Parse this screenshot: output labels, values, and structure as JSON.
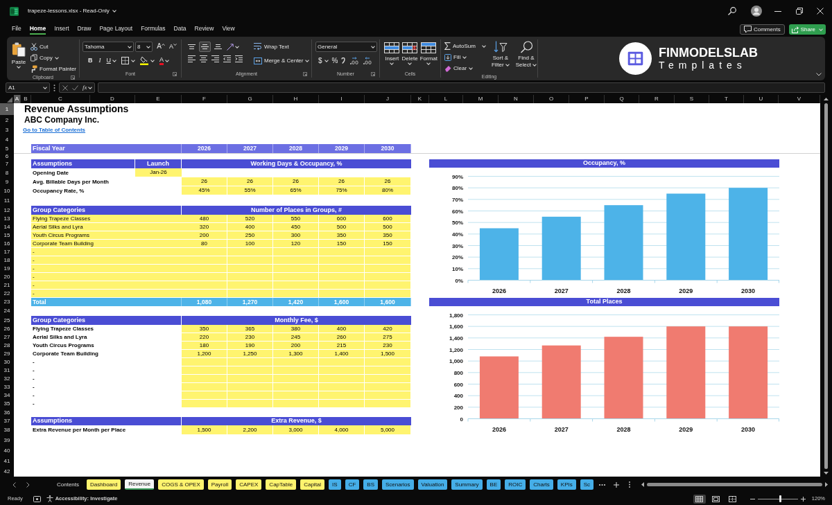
{
  "window": {
    "title": "trapeze-lessons.xlsx - Read-Only"
  },
  "menu_tabs": [
    {
      "label": "File",
      "selected": false
    },
    {
      "label": "Home",
      "selected": true
    },
    {
      "label": "Insert",
      "selected": false
    },
    {
      "label": "Draw",
      "selected": false
    },
    {
      "label": "Page Layout",
      "selected": false
    },
    {
      "label": "Formulas",
      "selected": false
    },
    {
      "label": "Data",
      "selected": false
    },
    {
      "label": "Review",
      "selected": false
    },
    {
      "label": "View",
      "selected": false
    }
  ],
  "actions": {
    "comments": "Comments",
    "share": "Share"
  },
  "ribbon": {
    "clipboard": {
      "label": "Clipboard",
      "paste": "Paste",
      "cut": "Cut",
      "copy": "Copy",
      "format_painter": "Format Painter"
    },
    "font": {
      "label": "Font",
      "font_name": "Tahoma",
      "font_size": "8",
      "grow": "A",
      "shrink": "A",
      "bold": "B",
      "italic": "I",
      "underline": "U",
      "font_color": "A"
    },
    "alignment": {
      "label": "Alignment",
      "vertical_align": [
        {
          "kind": "top",
          "selected": false
        },
        {
          "kind": "middle",
          "selected": true
        },
        {
          "kind": "bottom",
          "selected": false
        }
      ],
      "wrap_text": "Wrap Text",
      "merge_center": "Merge & Center"
    },
    "number": {
      "label": "Number",
      "format": "General",
      "currency": "$",
      "percent": "%"
    },
    "cells": {
      "label": "Cells",
      "buttons": [
        {
          "kind": "insert",
          "label": "Insert"
        },
        {
          "kind": "delete",
          "label": "Delete"
        },
        {
          "kind": "format",
          "label": "Format"
        }
      ]
    },
    "editing": {
      "label": "Editing",
      "autosum": "AutoSum",
      "fill": "Fill",
      "clear": "Clear",
      "sort_filter": "Sort & Filter",
      "find_select": "Find & Select"
    }
  },
  "logo": {
    "name": "FINMODELSLAB",
    "tagline": "Templates"
  },
  "formula_bar": {
    "cell": "A1",
    "function_label": "fx"
  },
  "columns": [
    {
      "label": "A",
      "selected": true
    },
    {
      "label": "B",
      "selected": false
    },
    {
      "label": "C",
      "selected": false
    },
    {
      "label": "D",
      "selected": false
    },
    {
      "label": "E",
      "selected": false
    },
    {
      "label": "F",
      "selected": false
    },
    {
      "label": "G",
      "selected": false
    },
    {
      "label": "H",
      "selected": false
    },
    {
      "label": "I",
      "selected": false
    },
    {
      "label": "J",
      "selected": false
    },
    {
      "label": "K",
      "selected": false
    },
    {
      "label": "L",
      "selected": false
    },
    {
      "label": "M",
      "selected": false
    },
    {
      "label": "N",
      "selected": false
    },
    {
      "label": "O",
      "selected": false
    },
    {
      "label": "P",
      "selected": false
    },
    {
      "label": "Q",
      "selected": false
    },
    {
      "label": "R",
      "selected": false
    },
    {
      "label": "S",
      "selected": false
    },
    {
      "label": "T",
      "selected": false
    },
    {
      "label": "U",
      "selected": false
    },
    {
      "label": "V",
      "selected": false
    }
  ],
  "row_numbers": [
    {
      "label": "1",
      "selected": true
    },
    {
      "label": "2",
      "selected": false
    },
    {
      "label": "3",
      "selected": false
    },
    {
      "label": "4",
      "selected": false
    },
    {
      "label": "5",
      "selected": false
    },
    {
      "label": "6",
      "selected": false
    },
    {
      "label": "7",
      "selected": false
    },
    {
      "label": "8",
      "selected": false
    },
    {
      "label": "9",
      "selected": false
    },
    {
      "label": "10",
      "selected": false
    },
    {
      "label": "11",
      "selected": false
    },
    {
      "label": "12",
      "selected": false
    },
    {
      "label": "13",
      "selected": false
    },
    {
      "label": "14",
      "selected": false
    },
    {
      "label": "15",
      "selected": false
    },
    {
      "label": "16",
      "selected": false
    },
    {
      "label": "17",
      "selected": false
    },
    {
      "label": "18",
      "selected": false
    },
    {
      "label": "19",
      "selected": false
    },
    {
      "label": "20",
      "selected": false
    },
    {
      "label": "21",
      "selected": false
    },
    {
      "label": "22",
      "selected": false
    },
    {
      "label": "23",
      "selected": false
    },
    {
      "label": "24",
      "selected": false
    },
    {
      "label": "25",
      "selected": false
    },
    {
      "label": "26",
      "selected": false
    },
    {
      "label": "27",
      "selected": false
    },
    {
      "label": "28",
      "selected": false
    },
    {
      "label": "29",
      "selected": false
    },
    {
      "label": "30",
      "selected": false
    },
    {
      "label": "31",
      "selected": false
    },
    {
      "label": "32",
      "selected": false
    },
    {
      "label": "33",
      "selected": false
    },
    {
      "label": "34",
      "selected": false
    },
    {
      "label": "35",
      "selected": false
    },
    {
      "label": "36",
      "selected": false
    },
    {
      "label": "37",
      "selected": false
    },
    {
      "label": "38",
      "selected": false
    },
    {
      "label": "39",
      "selected": false
    },
    {
      "label": "40",
      "selected": false
    },
    {
      "label": "41",
      "selected": false
    },
    {
      "label": "42",
      "selected": false
    }
  ],
  "sheet": {
    "title": "Revenue Assumptions",
    "subtitle": "ABC Company Inc.",
    "toc_link": "Go to Table of Contents",
    "fiscal_year": {
      "label": "Fiscal Year",
      "years": [
        "2026",
        "2027",
        "2028",
        "2029",
        "2030"
      ]
    },
    "sections": [
      {
        "header": {
          "label": "Assumptions",
          "launch": "Launch",
          "title": "Working Days & Occupancy, %"
        },
        "rows": [
          {
            "label": "Opening Date",
            "input_label": false,
            "launch": "Jan-26",
            "input_values": false
          },
          {
            "label": "Avg. Billable Days per Month",
            "input_label": false,
            "input_values": true,
            "values": [
              "26",
              "26",
              "26",
              "26",
              "26"
            ]
          },
          {
            "label": "Occupancy Rate, %",
            "input_label": false,
            "input_values": true,
            "values": [
              "45%",
              "55%",
              "65%",
              "75%",
              "80%"
            ]
          }
        ]
      },
      {
        "header": {
          "label": "Group Categories",
          "title": "Number of Places in Groups, #"
        },
        "rows": [
          {
            "label": "Flying Trapeze Classes",
            "input_label": true,
            "input_values": true,
            "values": [
              "480",
              "520",
              "550",
              "600",
              "600"
            ]
          },
          {
            "label": "Aerial Silks and Lyra",
            "input_label": true,
            "input_values": true,
            "values": [
              "320",
              "400",
              "450",
              "500",
              "500"
            ]
          },
          {
            "label": "Youth Circus Programs",
            "input_label": true,
            "input_values": true,
            "values": [
              "200",
              "250",
              "300",
              "350",
              "350"
            ]
          },
          {
            "label": "Corporate Team Building",
            "input_label": true,
            "input_values": true,
            "values": [
              "80",
              "100",
              "120",
              "150",
              "150"
            ]
          },
          {
            "label": "-",
            "input_label": true,
            "input_values": true
          },
          {
            "label": "-",
            "input_label": true,
            "input_values": true
          },
          {
            "label": "-",
            "input_label": true,
            "input_values": true
          },
          {
            "label": "-",
            "input_label": true,
            "input_values": true
          },
          {
            "label": "-",
            "input_label": true,
            "input_values": true
          },
          {
            "label": "-",
            "input_label": true,
            "input_values": true
          }
        ],
        "total": {
          "label": "Total",
          "values": [
            "1,080",
            "1,270",
            "1,420",
            "1,600",
            "1,600"
          ]
        }
      },
      {
        "header": {
          "label": "Group Categories",
          "title": "Monthly Fee, $"
        },
        "rows": [
          {
            "label": "Flying Trapeze Classes",
            "input_label": false,
            "input_values": true,
            "values": [
              "350",
              "365",
              "380",
              "400",
              "420"
            ]
          },
          {
            "label": "Aerial Silks and Lyra",
            "input_label": false,
            "input_values": true,
            "values": [
              "220",
              "230",
              "245",
              "260",
              "275"
            ]
          },
          {
            "label": "Youth Circus Programs",
            "input_label": false,
            "input_values": true,
            "values": [
              "180",
              "190",
              "200",
              "215",
              "230"
            ]
          },
          {
            "label": "Corporate Team Building",
            "input_label": false,
            "input_values": true,
            "values": [
              "1,200",
              "1,250",
              "1,300",
              "1,400",
              "1,500"
            ]
          },
          {
            "label": "-",
            "input_label": false,
            "input_values": true
          },
          {
            "label": "-",
            "input_label": false,
            "input_values": true
          },
          {
            "label": "-",
            "input_label": false,
            "input_values": true
          },
          {
            "label": "-",
            "input_label": false,
            "input_values": true
          },
          {
            "label": "-",
            "input_label": false,
            "input_values": true
          },
          {
            "label": "-",
            "input_label": false,
            "input_values": true
          }
        ]
      },
      {
        "header": {
          "label": "Assumptions",
          "title": "Extra Revenue, $"
        },
        "rows": [
          {
            "label": "Extra Revenue per Month per Place",
            "input_label": false,
            "input_values": true,
            "values": [
              "1,500",
              "2,200",
              "3,000",
              "4,000",
              "5,000"
            ]
          }
        ]
      }
    ]
  },
  "charts": [
    {
      "chart_data": {
        "type": "bar",
        "title": "Occupancy, %",
        "categories": [
          "2026",
          "2027",
          "2028",
          "2029",
          "2030"
        ],
        "series": [
          {
            "color": "#4db3e8",
            "values": [
              45,
              55,
              65,
              75,
              80
            ]
          }
        ],
        "ylim": [
          0,
          90
        ],
        "yticks": [
          {
            "value": 0,
            "label": "0%"
          },
          {
            "value": 10,
            "label": "10%"
          },
          {
            "value": 20,
            "label": "20%"
          },
          {
            "value": 30,
            "label": "30%"
          },
          {
            "value": 40,
            "label": "40%"
          },
          {
            "value": 50,
            "label": "50%"
          },
          {
            "value": 60,
            "label": "60%"
          },
          {
            "value": 70,
            "label": "70%"
          },
          {
            "value": 80,
            "label": "80%"
          },
          {
            "value": 90,
            "label": "90%"
          }
        ],
        "grid": true
      }
    },
    {
      "chart_data": {
        "type": "bar",
        "title": "Total Places",
        "categories": [
          "2026",
          "2027",
          "2028",
          "2029",
          "2030"
        ],
        "series": [
          {
            "color": "#f07b70",
            "values": [
              1080,
              1270,
              1420,
              1600,
              1600
            ]
          }
        ],
        "ylim": [
          0,
          1800
        ],
        "yticks": [
          {
            "value": 0,
            "label": "0"
          },
          {
            "value": 200,
            "label": "200"
          },
          {
            "value": 400,
            "label": "400"
          },
          {
            "value": 600,
            "label": "600"
          },
          {
            "value": 800,
            "label": "800"
          },
          {
            "value": 1000,
            "label": "1,000"
          },
          {
            "value": 1200,
            "label": "1,200"
          },
          {
            "value": 1400,
            "label": "1,400"
          },
          {
            "value": 1600,
            "label": "1,600"
          },
          {
            "value": 1800,
            "label": "1,800"
          }
        ],
        "grid": true
      }
    }
  ],
  "sheet_tabs": [
    {
      "label": "Contents",
      "selected": false
    },
    {
      "label": "Dashboard",
      "color": "#fff36e",
      "selected": false
    },
    {
      "label": "Revenue",
      "selected": true
    },
    {
      "label": "COGS & OPEX",
      "color": "#fff36e",
      "selected": false
    },
    {
      "label": "Payroll",
      "color": "#fff36e",
      "selected": false
    },
    {
      "label": "CAPEX",
      "color": "#fff36e",
      "selected": false
    },
    {
      "label": "CapTable",
      "color": "#fff36e",
      "selected": false
    },
    {
      "label": "Capital",
      "color": "#fff36e",
      "selected": false
    },
    {
      "label": "IS",
      "color": "#45aee8",
      "selected": false
    },
    {
      "label": "CF",
      "color": "#45aee8",
      "selected": false
    },
    {
      "label": "BS",
      "color": "#45aee8",
      "selected": false
    },
    {
      "label": "Scenarios",
      "color": "#45aee8",
      "selected": false
    },
    {
      "label": "Valuation",
      "color": "#45aee8",
      "selected": false
    },
    {
      "label": "Summary",
      "color": "#45aee8",
      "selected": false
    },
    {
      "label": "BE",
      "color": "#45aee8",
      "selected": false
    },
    {
      "label": "ROIC",
      "color": "#45aee8",
      "selected": false
    },
    {
      "label": "Charts",
      "color": "#45aee8",
      "selected": false
    },
    {
      "label": "KPIs",
      "color": "#45aee8",
      "selected": false
    },
    {
      "label": "Sc",
      "color": "#45aee8",
      "selected": false
    }
  ],
  "status_bar": {
    "mode": "Ready",
    "accessibility": "Accessibility: Investigate",
    "views": [
      {
        "kind": "normal",
        "selected": true
      },
      {
        "kind": "page_layout",
        "selected": false
      },
      {
        "kind": "page_break",
        "selected": false
      }
    ],
    "zoom": {
      "level": 0.55,
      "reading": "120%"
    }
  }
}
